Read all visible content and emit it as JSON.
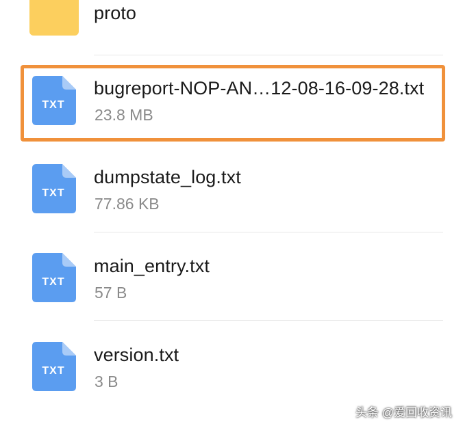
{
  "files": [
    {
      "name": "proto",
      "meta": "",
      "type": "folder",
      "icon": "folder-icon"
    },
    {
      "name": "bugreport-NOP-AN…12-08-16-09-28.txt",
      "meta": "23.8 MB",
      "type": "txt",
      "icon": "txt-file-icon",
      "icon_label": "TXT"
    },
    {
      "name": "dumpstate_log.txt",
      "meta": "77.86 KB",
      "type": "txt",
      "icon": "txt-file-icon",
      "icon_label": "TXT"
    },
    {
      "name": "main_entry.txt",
      "meta": "57 B",
      "type": "txt",
      "icon": "txt-file-icon",
      "icon_label": "TXT"
    },
    {
      "name": "version.txt",
      "meta": "3 B",
      "type": "txt",
      "icon": "txt-file-icon",
      "icon_label": "TXT"
    }
  ],
  "highlight": {
    "color": "#f0913b",
    "target": "bugreport-NOP-AN…12-08-16-09-28.txt"
  },
  "colors": {
    "folder": "#fccf5e",
    "txt_icon": "#5b9df0",
    "txt_fold": "#a9cbf7"
  },
  "watermark": "头条 @爱回收资讯"
}
